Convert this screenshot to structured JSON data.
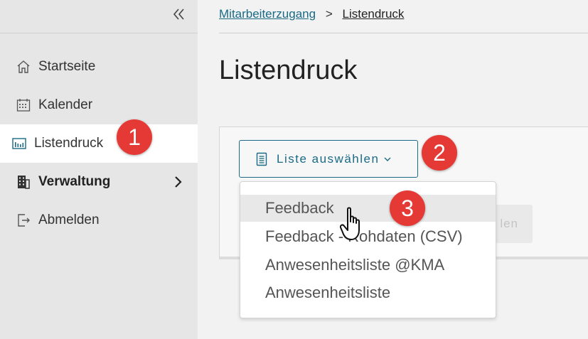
{
  "sidebar": {
    "items": [
      {
        "label": "Startseite",
        "icon": "home-icon"
      },
      {
        "label": "Kalender",
        "icon": "calendar-icon"
      },
      {
        "label": "Listendruck",
        "icon": "chart-icon",
        "active": true
      },
      {
        "label": "Verwaltung",
        "icon": "building-icon",
        "bold": true
      },
      {
        "label": "Abmelden",
        "icon": "logout-icon"
      }
    ]
  },
  "breadcrumb": {
    "parent": "Mitarbeiterzugang",
    "separator": ">",
    "current": "Listendruck"
  },
  "page": {
    "title": "Listendruck"
  },
  "toolbar": {
    "select_label": "Liste auswählen",
    "hidden_button_label": "len"
  },
  "dropdown": {
    "options": [
      "Feedback",
      "Feedback - Rohdaten (CSV)",
      "Anwesenheitsliste @KMA",
      "Anwesenheitsliste"
    ],
    "hovered_index": 0
  },
  "badges": [
    "1",
    "2",
    "3"
  ],
  "colors": {
    "accent": "#1a6a86",
    "badge": "#e53935",
    "sidebar_bg": "#e6e6e6"
  }
}
